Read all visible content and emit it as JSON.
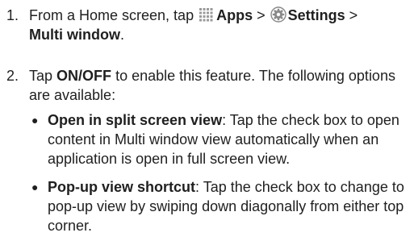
{
  "steps": [
    {
      "number": "1.",
      "prefix": "From a Home screen, tap",
      "apps_label": "Apps",
      "sep1": ">",
      "settings_label": "Settings",
      "sep2": ">",
      "multi_window_label": "Multi window",
      "period": "."
    },
    {
      "number": "2.",
      "tap": "Tap",
      "onoff_label": "ON/OFF",
      "rest": "to enable this feature. The following options are available:"
    }
  ],
  "options": [
    {
      "title": "Open in split screen view",
      "description": ": Tap the check box to open content in Multi window view automatically when an application is open in full screen view."
    },
    {
      "title": "Pop-up view shortcut",
      "description": ": Tap the check box to change to pop-up view by swiping down diagonally from either top corner."
    }
  ],
  "icons": {
    "apps": "apps-grid-icon",
    "settings": "settings-gear-icon"
  },
  "colors": {
    "text": "#1f1f1f",
    "apps_icon": "#9a9a9a",
    "settings_icon": "#8a8a8a"
  }
}
